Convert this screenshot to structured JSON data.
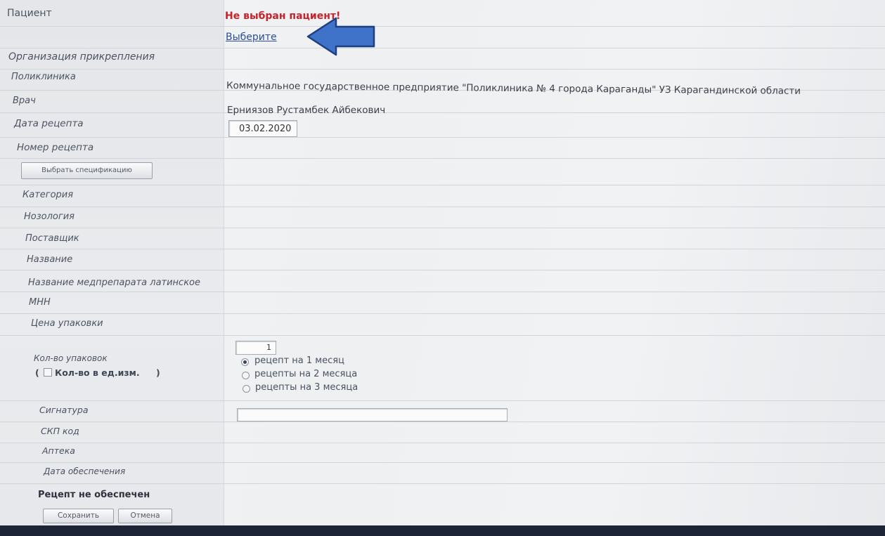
{
  "form": {
    "patient": {
      "label": "Пациент",
      "error": "Не выбран пациент!",
      "link": "Выберите"
    },
    "organization": {
      "label": "Организация прикрепления"
    },
    "clinic": {
      "label": "Поликлиника",
      "value": "Коммунальное государственное предприятие \"Поликлиника № 4 города Караганды\" УЗ Карагандинской области"
    },
    "doctor": {
      "label": "Врач",
      "value": "Ерниязов Рустамбек Айбекович"
    },
    "prescription_date": {
      "label": "Дата рецепта",
      "value": "03.02.2020"
    },
    "prescription_number": {
      "label": "Номер рецепта"
    },
    "choose_spec_button": "Выбрать спецификацию",
    "spec_fields": [
      "Категория",
      "Нозология",
      "Поставщик",
      "Название",
      "Название медпрепарата латинское",
      "МНН",
      "Цена упаковки"
    ],
    "packages": {
      "label": "Кол-во упаковок",
      "unit_checkbox_label": "Кол-во в ед.изм.",
      "value": "1",
      "options": [
        "рецепт на 1 месяц",
        "рецепты на 2 месяца",
        "рецепты на 3 месяца"
      ],
      "selected": 0
    },
    "signature": {
      "label": "Сигнатура",
      "value": ""
    },
    "skp_code": {
      "label": "СКП код"
    },
    "pharmacy": {
      "label": "Аптека"
    },
    "supply_date": {
      "label": "Дата обеспечения"
    },
    "status": "Рецепт не обеспечен",
    "save_button": "Сохранить",
    "cancel_button": "Отмена"
  },
  "annotation": {
    "arrow_color": "#3f72c9",
    "arrow_border": "#1e3f80"
  }
}
